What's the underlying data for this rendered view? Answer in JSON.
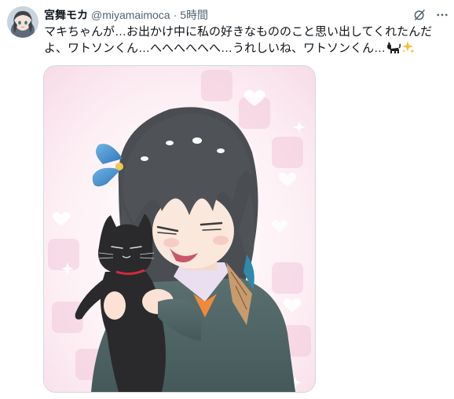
{
  "tweet": {
    "author": {
      "display_name": "宮舞モカ",
      "handle": "@miyamaimoca",
      "separator": "·",
      "timestamp": "5時間"
    },
    "text_lines": [
      "マキちゃんが…お出かけ中に私の好きなもののこと思い出してくれたんだ",
      "よ、ワトソンくん…へへへへへへ…うれしいね、ワトソンくん…"
    ],
    "trailing_emojis": [
      "black-cat",
      "sparkles"
    ],
    "media": {
      "type": "illustration",
      "subject": "anime girl hugging a black cat"
    }
  },
  "icons": {
    "grok": "grok-icon",
    "more": "more-options-icon"
  },
  "colors": {
    "text_primary": "#0f1419",
    "text_secondary": "#536471",
    "border": "#cfd9de",
    "sparkle": "#f5c13a"
  }
}
